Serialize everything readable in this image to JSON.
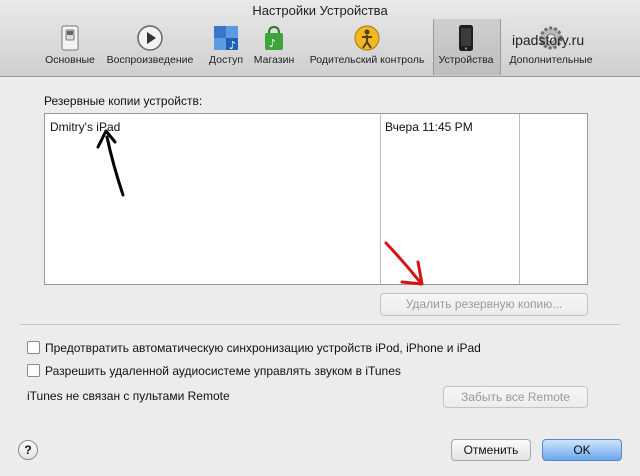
{
  "window": {
    "title": "Настройки Устройства"
  },
  "toolbar": {
    "items": [
      {
        "label": "Основные",
        "icon": "switch-icon"
      },
      {
        "label": "Воспроизведение",
        "icon": "play-icon"
      },
      {
        "label": "Доступ",
        "icon": "sharing-icon"
      },
      {
        "label": "Магазин",
        "icon": "store-bag-icon"
      },
      {
        "label": "Родительский контроль",
        "icon": "parental-control-icon"
      },
      {
        "label": "Устройства",
        "icon": "device-icon"
      },
      {
        "label": "Дополнительные",
        "icon": "gear-icon"
      }
    ],
    "active": "Устройства"
  },
  "watermark": "ipadstory.ru",
  "backups": {
    "section_label": "Резервные копии устройств:",
    "rows": [
      {
        "device": "Dmitry's iPad",
        "date": "Вчера 11:45 PM"
      }
    ],
    "delete_button": "Удалить резервную копию..."
  },
  "options": {
    "prevent_sync": "Предотвратить автоматическую синхронизацию устройств iPod, iPhone и iPad",
    "allow_remote_audio": "Разрешить удаленной аудиосистеме управлять звуком в iTunes",
    "remote_status": "iTunes не связан с пультами Remote",
    "forget_remotes_button": "Забыть все Remote"
  },
  "footer": {
    "help": "?",
    "cancel": "Отменить",
    "ok": "OK"
  }
}
